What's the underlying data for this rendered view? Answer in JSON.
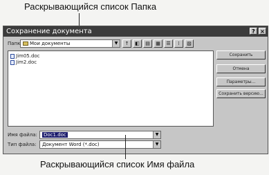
{
  "callouts": {
    "top": "Раскрывающийся список Папка",
    "bottom": "Раскрывающийся список Имя файла"
  },
  "dialog": {
    "title": "Сохранение документа",
    "help_button": "?",
    "close_button": "×",
    "folder_label": "Папка:",
    "folder_value": "Мои документы",
    "toolbar": [
      "↑",
      "◧",
      "▤",
      "▦",
      "☰",
      "⁞",
      "▧"
    ],
    "files": [
      "Jim05.doc",
      "Jim2.doc"
    ],
    "buttons": [
      "Сохранить",
      "Отмена",
      "Параметры...",
      "Сохранить версию..."
    ],
    "filename_label": "Имя файла:",
    "filename_value": "Doc1.doc",
    "filetype_label": "Тип файла:",
    "filetype_value": "Документ Word (*.doc)"
  }
}
